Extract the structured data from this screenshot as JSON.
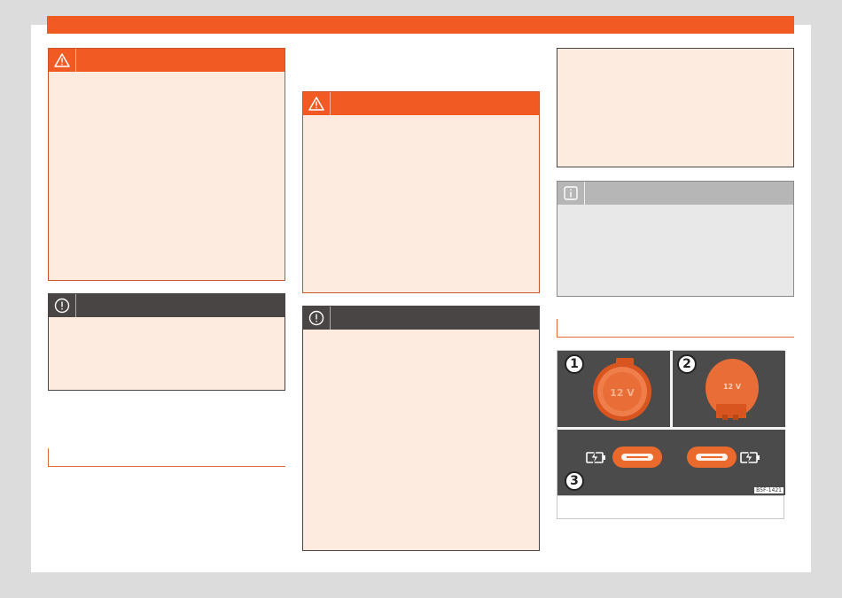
{
  "colors": {
    "brand": "#f25a23",
    "warning_bg": "#fdebdf",
    "notice_head": "#4a4545",
    "info_head": "#b6b6b6"
  },
  "boxes": {
    "warning_1": {
      "icon": "warning-triangle-icon"
    },
    "notice_1": {
      "icon": "exclamation-circle-icon"
    },
    "warning_2": {
      "icon": "warning-triangle-icon"
    },
    "notice_2": {
      "icon": "exclamation-circle-icon"
    },
    "info_1": {
      "icon": "info-icon"
    }
  },
  "figure": {
    "callouts": [
      "1",
      "2",
      "3"
    ],
    "socket_label": "12 V",
    "figure_code": "B5F-1421",
    "usb_icon": "battery-charge-icon"
  }
}
